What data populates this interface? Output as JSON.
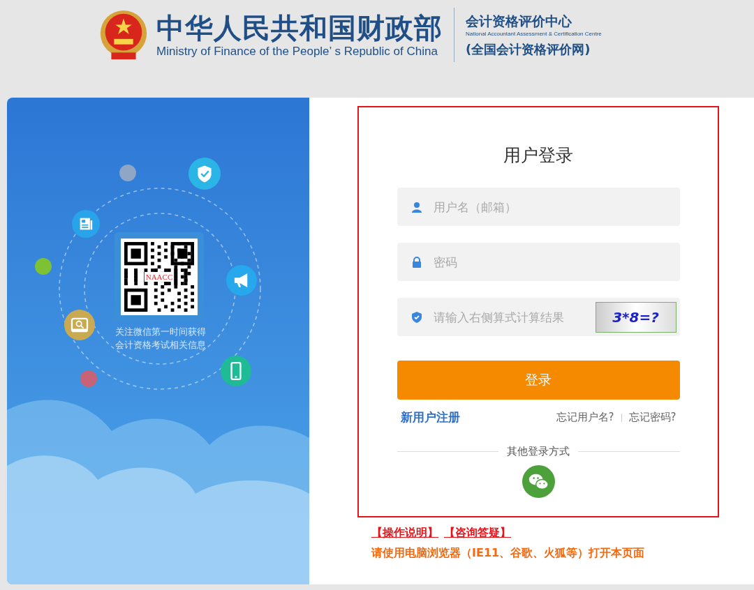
{
  "header": {
    "title_cn": "中华人民共和国财政部",
    "title_en": "Ministry of Finance of the People’ s Republic of China",
    "center_cn": "会计资格评价中心",
    "center_en": "National Accountant Assessment & Certification Centre",
    "site": "(全国会计资格评价网)"
  },
  "promo": {
    "qr_label": "NAACC",
    "caption": [
      "关注微信第一时间获得",
      "会计资格考试相关信息"
    ]
  },
  "login": {
    "title": "用户登录",
    "fields": [
      {
        "kind": "user",
        "placeholder": "用户名（邮箱）"
      },
      {
        "kind": "password",
        "placeholder": "密码"
      },
      {
        "kind": "captcha",
        "placeholder": "请输入右侧算式计算结果",
        "captcha": "3*8=?"
      }
    ],
    "submit": "登录",
    "register": "新用户注册",
    "forgot_user": "忘记用户名?",
    "forgot_password": "忘记密码?",
    "other": "其他登录方式"
  },
  "help_links": [
    "【操作说明】",
    "【咨询答疑】"
  ],
  "notice": "请使用电脑浏览器（IE11、谷歌、火狐等）打开本页面"
}
